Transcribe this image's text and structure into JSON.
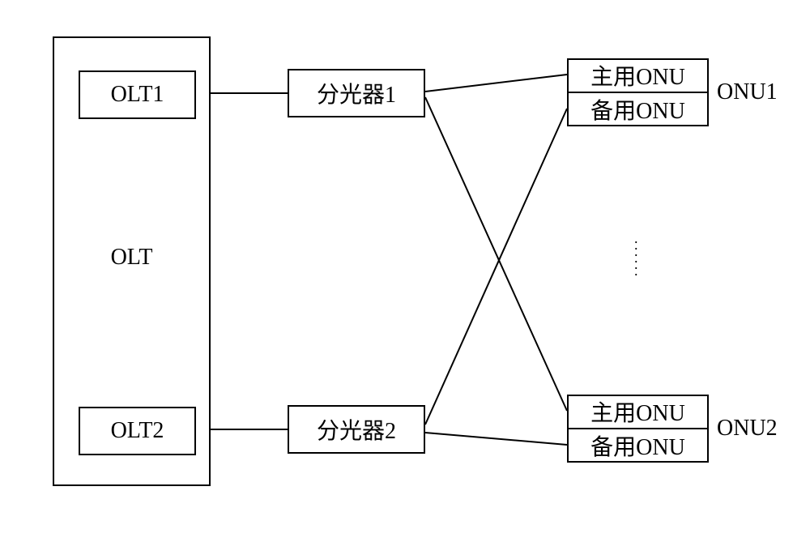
{
  "olt": {
    "outer_label": "OLT",
    "port1": "OLT1",
    "port2": "OLT2"
  },
  "splitters": {
    "s1": "分光器1",
    "s2": "分光器2"
  },
  "onu": {
    "primary": "主用ONU",
    "standby": "备用ONU",
    "group1_label": "ONU1",
    "group2_label": "ONU2"
  }
}
